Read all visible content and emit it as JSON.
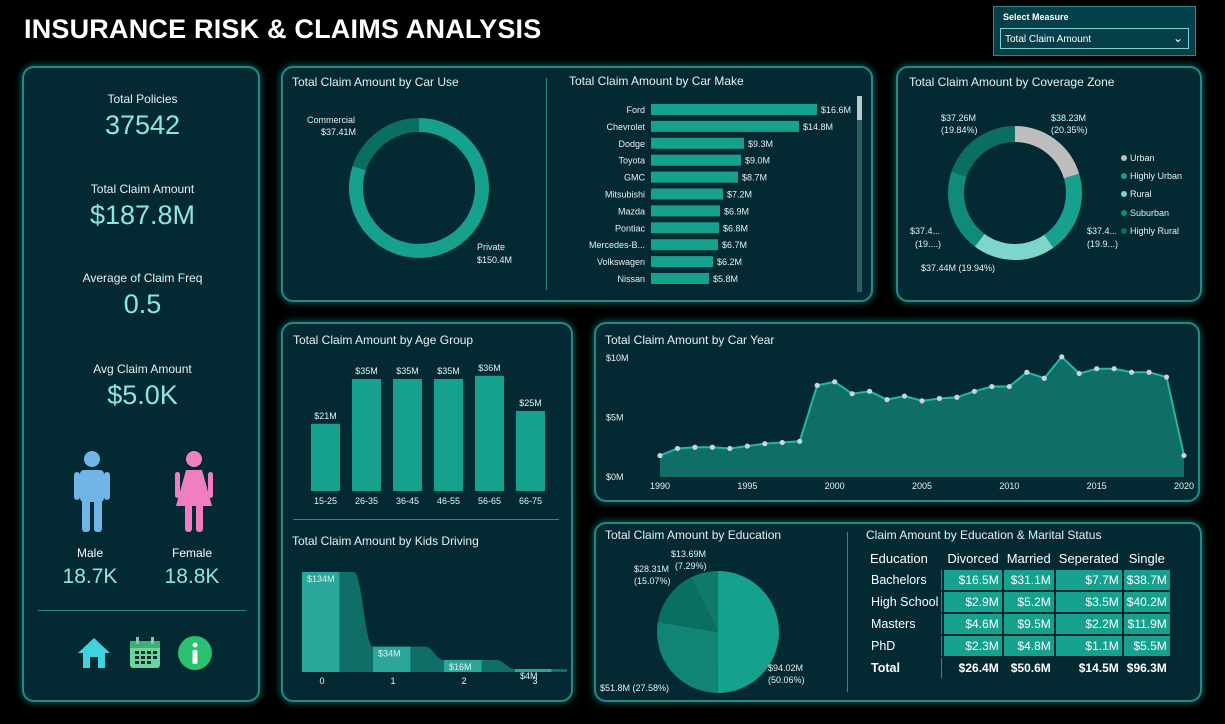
{
  "title": "INSURANCE RISK & CLAIMS ANALYSIS",
  "measure": {
    "label": "Select Measure",
    "value": "Total Claim Amount"
  },
  "kpis": [
    {
      "label": "Total Policies",
      "value": "37542"
    },
    {
      "label": "Total Claim Amount",
      "value": "$187.8M"
    },
    {
      "label": "Average of Claim Freq",
      "value": "0.5"
    },
    {
      "label": "Avg Claim Amount",
      "value": "$5.0K"
    }
  ],
  "gender": {
    "male_label": "Male",
    "male_value": "18.7K",
    "female_label": "Female",
    "female_value": "18.8K"
  },
  "colors": {
    "accent": "#16a08e",
    "panel": "#032a32",
    "border": "#1f8c86",
    "male": "#6fb6e6",
    "female": "#ef7fc0"
  },
  "nav_icons": [
    "home-icon",
    "calendar-icon",
    "info-icon"
  ],
  "car_use": {
    "title": "Total Claim Amount by Car Use",
    "labels": {
      "commercial": "Commercial",
      "commercial_value": "$37.41M",
      "private": "Private",
      "private_value": "$150.4M"
    }
  },
  "car_make": {
    "title": "Total Claim Amount by Car Make"
  },
  "coverage": {
    "title": "Total Claim Amount by Coverage Zone",
    "labels": [
      "$38.23M",
      "(20.35%)",
      "$37.26M",
      "(19.84%)",
      "$37.4...",
      "(19.9...)",
      "$37.44M (19.94%)",
      "$37.4...",
      "(19....)"
    ],
    "legend": [
      "Urban",
      "Highly Urban",
      "Rural",
      "Suburban",
      "Highly Rural"
    ]
  },
  "age": {
    "title": "Total Claim Amount by Age Group"
  },
  "kids": {
    "title": "Total Claim Amount by Kids Driving"
  },
  "car_year": {
    "title": "Total Claim Amount by Car Year"
  },
  "education": {
    "title": "Total Claim Amount by Education",
    "labels": [
      "$13.69M",
      "(7.29%)",
      "$28.31M",
      "(15.07%)",
      "$51.8M (27.58%)",
      "$94.02M",
      "(50.06%)"
    ]
  },
  "edu_marital": {
    "title": "Claim Amount by Education & Marital Status",
    "headers": [
      "Education",
      "Divorced",
      "Married",
      "Seperated",
      "Single"
    ],
    "rows": [
      [
        "Bachelors",
        "$16.5M",
        "$31.1M",
        "$7.7M",
        "$38.7M"
      ],
      [
        "High School",
        "$2.9M",
        "$5.2M",
        "$3.5M",
        "$40.2M"
      ],
      [
        "Masters",
        "$4.6M",
        "$9.5M",
        "$2.2M",
        "$11.9M"
      ],
      [
        "PhD",
        "$2.3M",
        "$4.8M",
        "$1.1M",
        "$5.5M"
      ]
    ],
    "total": [
      "Total",
      "$26.4M",
      "$50.6M",
      "$14.5M",
      "$96.3M"
    ]
  },
  "chart_data": [
    {
      "type": "pie",
      "title": "Total Claim Amount by Car Use",
      "categories": [
        "Commercial",
        "Private"
      ],
      "values": [
        37.41,
        150.4
      ],
      "value_labels": [
        "$37.41M",
        "$150.4M"
      ]
    },
    {
      "type": "bar",
      "title": "Total Claim Amount by Car Make",
      "orientation": "horizontal",
      "categories": [
        "Ford",
        "Chevrolet",
        "Dodge",
        "Toyota",
        "GMC",
        "Mitsubishi",
        "Mazda",
        "Pontiac",
        "Mercedes-B...",
        "Volkswagen",
        "Nissan"
      ],
      "values": [
        16.6,
        14.8,
        9.3,
        9.0,
        8.7,
        7.2,
        6.9,
        6.8,
        6.7,
        6.2,
        5.8
      ],
      "value_labels": [
        "$16.6M",
        "$14.8M",
        "$9.3M",
        "$9.0M",
        "$8.7M",
        "$7.2M",
        "$6.9M",
        "$6.8M",
        "$6.7M",
        "$6.2M",
        "$5.8M"
      ]
    },
    {
      "type": "pie",
      "title": "Total Claim Amount by Coverage Zone",
      "categories": [
        "Urban",
        "Highly Urban",
        "Rural",
        "Suburban",
        "Highly Rural"
      ],
      "values": [
        38.23,
        37.4,
        37.44,
        37.4,
        37.26
      ]
    },
    {
      "type": "bar",
      "title": "Total Claim Amount by Age Group",
      "categories": [
        "15-25",
        "26-35",
        "36-45",
        "46-55",
        "56-65",
        "66-75"
      ],
      "values": [
        21,
        35,
        35,
        35,
        36,
        25
      ],
      "value_labels": [
        "$21M",
        "$35M",
        "$35M",
        "$35M",
        "$36M",
        "$25M"
      ],
      "ylim": [
        0,
        40
      ]
    },
    {
      "type": "area",
      "title": "Total Claim Amount by Kids Driving",
      "categories": [
        "0",
        "1",
        "2",
        "3"
      ],
      "values": [
        134,
        34,
        16,
        4
      ],
      "value_labels": [
        "$134M",
        "$34M",
        "$16M",
        "$4M"
      ]
    },
    {
      "type": "area",
      "title": "Total Claim Amount by Car Year",
      "x": [
        1990,
        1991,
        1992,
        1993,
        1994,
        1995,
        1996,
        1997,
        1998,
        1999,
        2000,
        2001,
        2002,
        2003,
        2004,
        2005,
        2006,
        2007,
        2008,
        2009,
        2010,
        2011,
        2012,
        2013,
        2014,
        2015,
        2016,
        2017,
        2018,
        2019,
        2020
      ],
      "y": [
        1.8,
        2.4,
        2.5,
        2.5,
        2.4,
        2.6,
        2.8,
        2.9,
        3.0,
        7.7,
        8.0,
        7.0,
        7.2,
        6.5,
        6.8,
        6.4,
        6.6,
        6.7,
        7.2,
        7.6,
        7.6,
        8.8,
        8.3,
        10.1,
        8.7,
        9.1,
        9.1,
        8.8,
        8.8,
        8.4,
        1.8
      ],
      "yticks": [
        "$0M",
        "$5M",
        "$10M"
      ],
      "xticks": [
        "1990",
        "1995",
        "2000",
        "2005",
        "2010",
        "2015",
        "2020"
      ],
      "ylim": [
        0,
        10
      ]
    },
    {
      "type": "pie",
      "title": "Total Claim Amount by Education",
      "values": [
        94.02,
        51.8,
        28.31,
        13.69
      ],
      "percent": [
        50.06,
        27.58,
        15.07,
        7.29
      ]
    }
  ]
}
